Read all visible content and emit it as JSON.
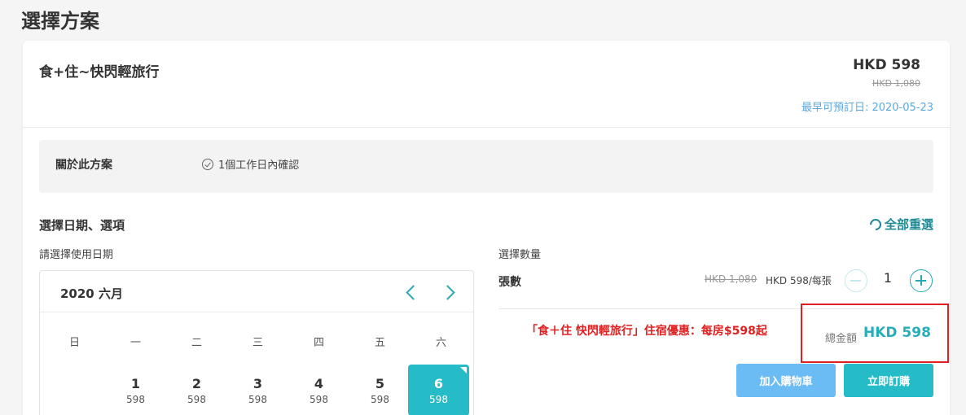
{
  "page": {
    "title": "選擇方案"
  },
  "plan": {
    "name": "食+住~快閃輕旅行",
    "price": "HKD 598",
    "original_price": "HKD 1,080",
    "earliest_booking": "最早可預訂日: 2020-05-23"
  },
  "about": {
    "label": "關於此方案",
    "confirm_text": "1個工作日內確認"
  },
  "selection": {
    "title": "選擇日期、選項",
    "reset_label": "全部重選",
    "date_label": "請選擇使用日期"
  },
  "calendar": {
    "month": "2020 六月",
    "weekdays": [
      "日",
      "一",
      "二",
      "三",
      "四",
      "五",
      "六"
    ],
    "days": [
      {
        "num": "1",
        "price": "598"
      },
      {
        "num": "2",
        "price": "598"
      },
      {
        "num": "3",
        "price": "598"
      },
      {
        "num": "4",
        "price": "598"
      },
      {
        "num": "5",
        "price": "598"
      },
      {
        "num": "6",
        "price": "598"
      }
    ],
    "selected_day": "6"
  },
  "quantity": {
    "label": "選擇數量",
    "item_name": "張數",
    "unit_original": "HKD 1,080",
    "unit_price": "HKD 598/每張",
    "value": "1"
  },
  "promo": {
    "text": "「食＋住 快閃輕旅行」住宿優惠：每房$598起"
  },
  "total": {
    "label": "總金額",
    "value": "HKD 598"
  },
  "buttons": {
    "add_to_cart": "加入購物車",
    "book_now": "立即訂購"
  },
  "colors": {
    "accent": "#26bcc7",
    "link_blue": "#5aa9df",
    "promo_red": "#e02020",
    "cart_button": "#6bbcf5"
  }
}
